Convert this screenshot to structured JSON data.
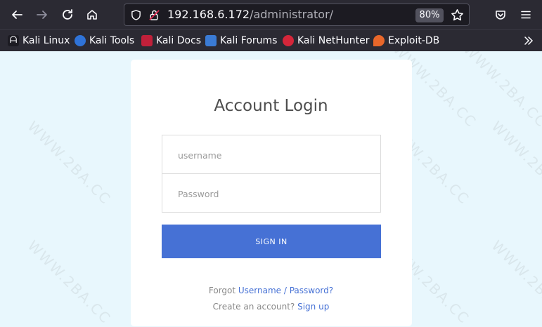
{
  "browser": {
    "url_host": "192.168.6.172",
    "url_path": "/administrator/",
    "zoom": "80%",
    "bookmarks": [
      {
        "label": "Kali Linux",
        "color": "#1c1b22"
      },
      {
        "label": "Kali Tools",
        "color": "#2f73d8"
      },
      {
        "label": "Kali Docs",
        "color": "#c0203a"
      },
      {
        "label": "Kali Forums",
        "color": "#3a7bd5"
      },
      {
        "label": "Kali NetHunter",
        "color": "#d5263a"
      },
      {
        "label": "Exploit-DB",
        "color": "#e8672a"
      }
    ]
  },
  "login": {
    "title": "Account Login",
    "username_placeholder": "username",
    "password_placeholder": "Password",
    "signin_label": "SIGN IN",
    "forgot_prefix": "Forgot ",
    "forgot_link": "Username / Password?",
    "create_prefix": "Create an account? ",
    "signup_link": "Sign up"
  },
  "watermark": "WWW.2BA.CC",
  "colors": {
    "accent": "#4671d5",
    "page_bg": "#e8f7fd",
    "toolbar_bg": "#2b2a33"
  }
}
